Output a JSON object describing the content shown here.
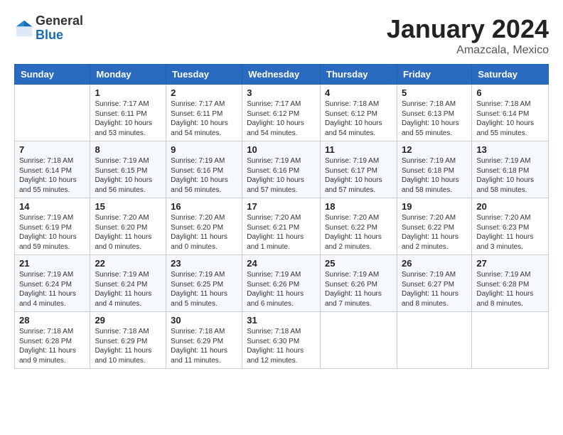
{
  "header": {
    "logo_general": "General",
    "logo_blue": "Blue",
    "month_title": "January 2024",
    "location": "Amazcala, Mexico"
  },
  "days_of_week": [
    "Sunday",
    "Monday",
    "Tuesday",
    "Wednesday",
    "Thursday",
    "Friday",
    "Saturday"
  ],
  "weeks": [
    [
      {
        "day": "",
        "sunrise": "",
        "sunset": "",
        "daylight": ""
      },
      {
        "day": "1",
        "sunrise": "Sunrise: 7:17 AM",
        "sunset": "Sunset: 6:11 PM",
        "daylight": "Daylight: 10 hours and 53 minutes."
      },
      {
        "day": "2",
        "sunrise": "Sunrise: 7:17 AM",
        "sunset": "Sunset: 6:11 PM",
        "daylight": "Daylight: 10 hours and 54 minutes."
      },
      {
        "day": "3",
        "sunrise": "Sunrise: 7:17 AM",
        "sunset": "Sunset: 6:12 PM",
        "daylight": "Daylight: 10 hours and 54 minutes."
      },
      {
        "day": "4",
        "sunrise": "Sunrise: 7:18 AM",
        "sunset": "Sunset: 6:12 PM",
        "daylight": "Daylight: 10 hours and 54 minutes."
      },
      {
        "day": "5",
        "sunrise": "Sunrise: 7:18 AM",
        "sunset": "Sunset: 6:13 PM",
        "daylight": "Daylight: 10 hours and 55 minutes."
      },
      {
        "day": "6",
        "sunrise": "Sunrise: 7:18 AM",
        "sunset": "Sunset: 6:14 PM",
        "daylight": "Daylight: 10 hours and 55 minutes."
      }
    ],
    [
      {
        "day": "7",
        "sunrise": "Sunrise: 7:18 AM",
        "sunset": "Sunset: 6:14 PM",
        "daylight": "Daylight: 10 hours and 55 minutes."
      },
      {
        "day": "8",
        "sunrise": "Sunrise: 7:19 AM",
        "sunset": "Sunset: 6:15 PM",
        "daylight": "Daylight: 10 hours and 56 minutes."
      },
      {
        "day": "9",
        "sunrise": "Sunrise: 7:19 AM",
        "sunset": "Sunset: 6:16 PM",
        "daylight": "Daylight: 10 hours and 56 minutes."
      },
      {
        "day": "10",
        "sunrise": "Sunrise: 7:19 AM",
        "sunset": "Sunset: 6:16 PM",
        "daylight": "Daylight: 10 hours and 57 minutes."
      },
      {
        "day": "11",
        "sunrise": "Sunrise: 7:19 AM",
        "sunset": "Sunset: 6:17 PM",
        "daylight": "Daylight: 10 hours and 57 minutes."
      },
      {
        "day": "12",
        "sunrise": "Sunrise: 7:19 AM",
        "sunset": "Sunset: 6:18 PM",
        "daylight": "Daylight: 10 hours and 58 minutes."
      },
      {
        "day": "13",
        "sunrise": "Sunrise: 7:19 AM",
        "sunset": "Sunset: 6:18 PM",
        "daylight": "Daylight: 10 hours and 58 minutes."
      }
    ],
    [
      {
        "day": "14",
        "sunrise": "Sunrise: 7:19 AM",
        "sunset": "Sunset: 6:19 PM",
        "daylight": "Daylight: 10 hours and 59 minutes."
      },
      {
        "day": "15",
        "sunrise": "Sunrise: 7:20 AM",
        "sunset": "Sunset: 6:20 PM",
        "daylight": "Daylight: 11 hours and 0 minutes."
      },
      {
        "day": "16",
        "sunrise": "Sunrise: 7:20 AM",
        "sunset": "Sunset: 6:20 PM",
        "daylight": "Daylight: 11 hours and 0 minutes."
      },
      {
        "day": "17",
        "sunrise": "Sunrise: 7:20 AM",
        "sunset": "Sunset: 6:21 PM",
        "daylight": "Daylight: 11 hours and 1 minute."
      },
      {
        "day": "18",
        "sunrise": "Sunrise: 7:20 AM",
        "sunset": "Sunset: 6:22 PM",
        "daylight": "Daylight: 11 hours and 2 minutes."
      },
      {
        "day": "19",
        "sunrise": "Sunrise: 7:20 AM",
        "sunset": "Sunset: 6:22 PM",
        "daylight": "Daylight: 11 hours and 2 minutes."
      },
      {
        "day": "20",
        "sunrise": "Sunrise: 7:20 AM",
        "sunset": "Sunset: 6:23 PM",
        "daylight": "Daylight: 11 hours and 3 minutes."
      }
    ],
    [
      {
        "day": "21",
        "sunrise": "Sunrise: 7:19 AM",
        "sunset": "Sunset: 6:24 PM",
        "daylight": "Daylight: 11 hours and 4 minutes."
      },
      {
        "day": "22",
        "sunrise": "Sunrise: 7:19 AM",
        "sunset": "Sunset: 6:24 PM",
        "daylight": "Daylight: 11 hours and 4 minutes."
      },
      {
        "day": "23",
        "sunrise": "Sunrise: 7:19 AM",
        "sunset": "Sunset: 6:25 PM",
        "daylight": "Daylight: 11 hours and 5 minutes."
      },
      {
        "day": "24",
        "sunrise": "Sunrise: 7:19 AM",
        "sunset": "Sunset: 6:26 PM",
        "daylight": "Daylight: 11 hours and 6 minutes."
      },
      {
        "day": "25",
        "sunrise": "Sunrise: 7:19 AM",
        "sunset": "Sunset: 6:26 PM",
        "daylight": "Daylight: 11 hours and 7 minutes."
      },
      {
        "day": "26",
        "sunrise": "Sunrise: 7:19 AM",
        "sunset": "Sunset: 6:27 PM",
        "daylight": "Daylight: 11 hours and 8 minutes."
      },
      {
        "day": "27",
        "sunrise": "Sunrise: 7:19 AM",
        "sunset": "Sunset: 6:28 PM",
        "daylight": "Daylight: 11 hours and 8 minutes."
      }
    ],
    [
      {
        "day": "28",
        "sunrise": "Sunrise: 7:18 AM",
        "sunset": "Sunset: 6:28 PM",
        "daylight": "Daylight: 11 hours and 9 minutes."
      },
      {
        "day": "29",
        "sunrise": "Sunrise: 7:18 AM",
        "sunset": "Sunset: 6:29 PM",
        "daylight": "Daylight: 11 hours and 10 minutes."
      },
      {
        "day": "30",
        "sunrise": "Sunrise: 7:18 AM",
        "sunset": "Sunset: 6:29 PM",
        "daylight": "Daylight: 11 hours and 11 minutes."
      },
      {
        "day": "31",
        "sunrise": "Sunrise: 7:18 AM",
        "sunset": "Sunset: 6:30 PM",
        "daylight": "Daylight: 11 hours and 12 minutes."
      },
      {
        "day": "",
        "sunrise": "",
        "sunset": "",
        "daylight": ""
      },
      {
        "day": "",
        "sunrise": "",
        "sunset": "",
        "daylight": ""
      },
      {
        "day": "",
        "sunrise": "",
        "sunset": "",
        "daylight": ""
      }
    ]
  ]
}
